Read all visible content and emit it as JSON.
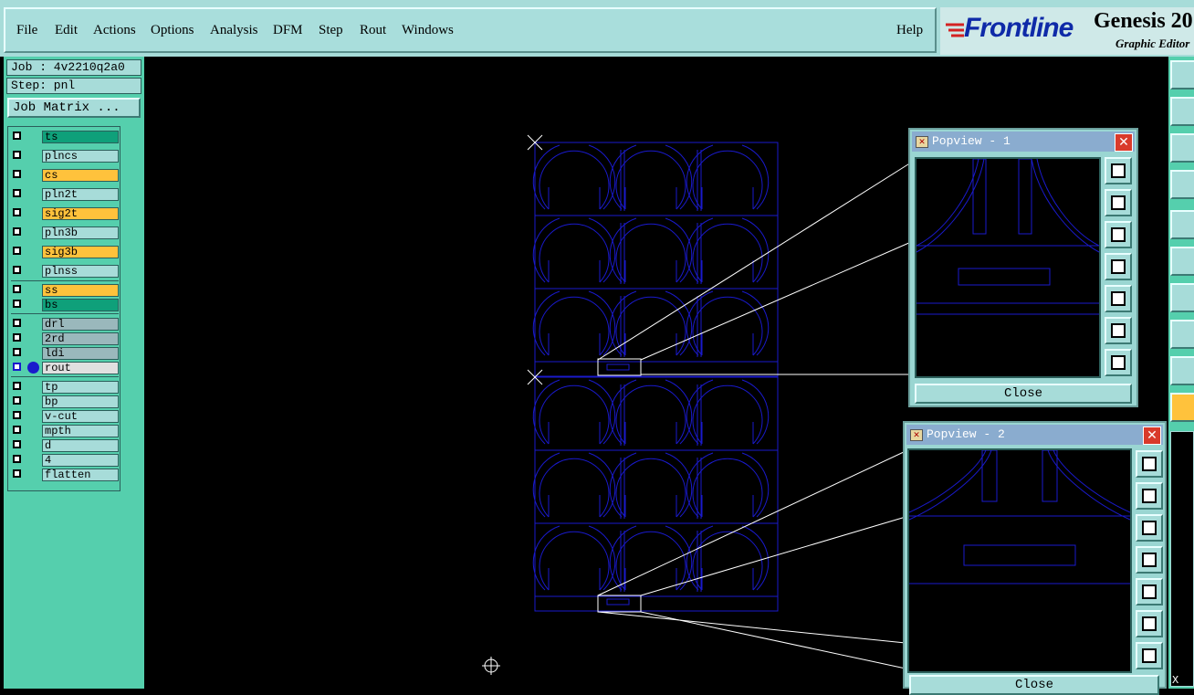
{
  "menu": {
    "items": [
      "File",
      "Edit",
      "Actions",
      "Options",
      "Analysis",
      "DFM",
      "Step",
      "Rout",
      "Windows"
    ],
    "help": "Help"
  },
  "brand": {
    "logo": "Frontline",
    "product": "Genesis 20",
    "subtitle": "Graphic Editor"
  },
  "job": {
    "job_label": "Job : 4v2210q2a0",
    "step_label": "Step: pnl",
    "matrix_button": "Job Matrix ..."
  },
  "layers": [
    {
      "name": "ts",
      "color": "#0fa07a"
    },
    {
      "name": "plncs",
      "color": "#a7dcd9"
    },
    {
      "name": "cs",
      "color": "#ffc23c"
    },
    {
      "name": "pln2t",
      "color": "#a7dcd9"
    },
    {
      "name": "sig2t",
      "color": "#ffc23c"
    },
    {
      "name": "pln3b",
      "color": "#a7dcd9"
    },
    {
      "name": "sig3b",
      "color": "#ffc23c"
    },
    {
      "name": "plnss",
      "color": "#a7dcd9"
    },
    {
      "name": "ss",
      "color": "#ffc23c"
    },
    {
      "name": "bs",
      "color": "#0fa07a"
    },
    {
      "name": "drl",
      "color": "#9ab8bc"
    },
    {
      "name": "2rd",
      "color": "#9ab8bc"
    },
    {
      "name": "ldi",
      "color": "#9ab8bc"
    },
    {
      "name": "rout",
      "color": "#e0e0e0"
    },
    {
      "name": "tp",
      "color": "#a7dcd9"
    },
    {
      "name": "bp",
      "color": "#a7dcd9"
    },
    {
      "name": "v-cut",
      "color": "#a7dcd9"
    },
    {
      "name": "mpth",
      "color": "#a7dcd9"
    },
    {
      "name": "d",
      "color": "#a7dcd9"
    },
    {
      "name": "4",
      "color": "#a7dcd9"
    },
    {
      "name": "flatten",
      "color": "#a7dcd9"
    }
  ],
  "popview1": {
    "title": "Popview - 1",
    "close": "Close"
  },
  "popview2": {
    "title": "Popview - 2",
    "close": "Close"
  },
  "colors": {
    "graphic": "#1a1acc",
    "background": "#000000",
    "panel": "#55cfad",
    "menubar": "#a7dcd9"
  },
  "statusbar": {
    "x_label": "X"
  }
}
